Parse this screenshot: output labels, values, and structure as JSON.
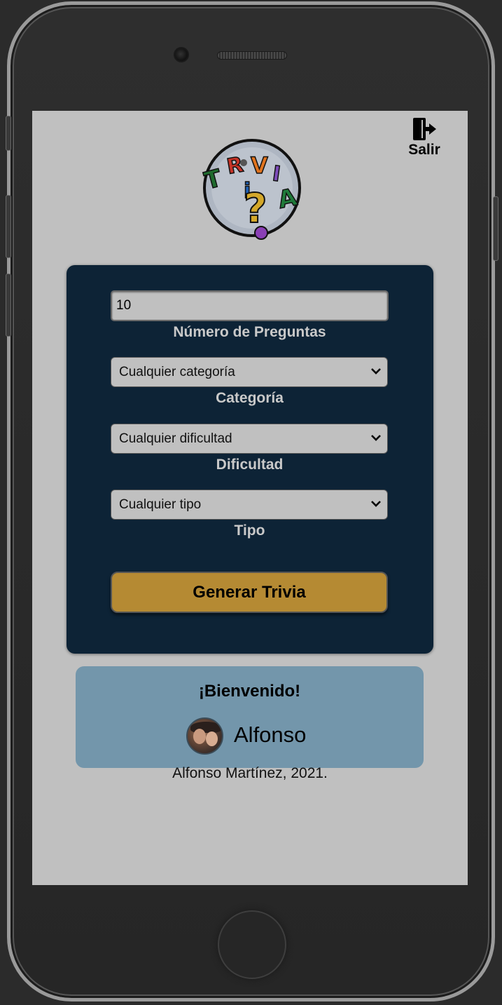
{
  "header": {
    "logout_label": "Salir",
    "logout_icon": "exit-door-icon",
    "logo_letters": [
      "T",
      "R",
      "i",
      "V",
      "I",
      "A",
      "?"
    ]
  },
  "form": {
    "question_count": {
      "value": "10",
      "label": "Número de Preguntas"
    },
    "category": {
      "selected": "Cualquier categoría",
      "label": "Categoría"
    },
    "difficulty": {
      "selected": "Cualquier dificultad",
      "label": "Dificultad"
    },
    "type": {
      "selected": "Cualquier tipo",
      "label": "Tipo"
    },
    "submit_label": "Generar Trivia"
  },
  "welcome": {
    "title": "¡Bienvenido!",
    "user_name": "Alfonso"
  },
  "footer": {
    "credit": "Alfonso Martínez, 2021."
  },
  "colors": {
    "screen_bg": "#c0c0c0",
    "panel_bg": "#0d2336",
    "button_gold": "#b58a33",
    "welcome_bg": "#7396ab",
    "label_gray": "#c9c9c9"
  }
}
